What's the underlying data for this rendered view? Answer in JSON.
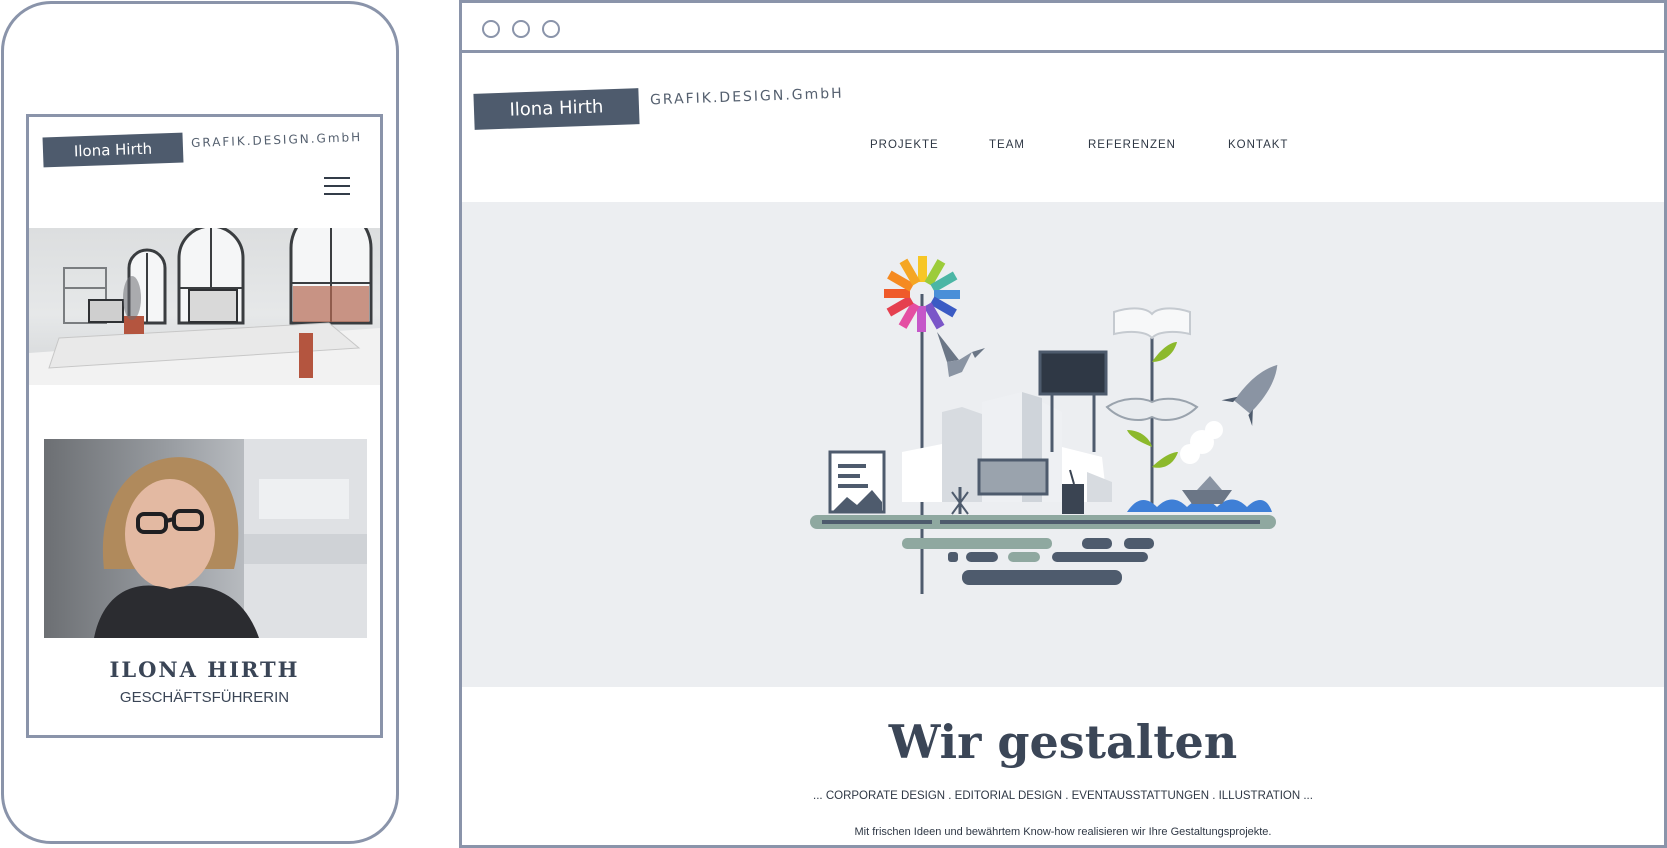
{
  "brand": {
    "name": "Ilona Hirth",
    "subtitle": "GRAFIK.DESIGN.GmbH"
  },
  "mobile": {
    "person_name": "ILONA HIRTH",
    "person_role": "GESCHÄFTSFÜHRERIN",
    "menu_icon": "hamburger-icon"
  },
  "browser": {
    "nav": [
      "PROJEKTE",
      "TEAM",
      "REFERENZEN",
      "KONTAKT"
    ],
    "headline": "Wir gestalten",
    "tagline": "... CORPORATE DESIGN . EDITORIAL DESIGN . EVENTAUSSTATTUNGEN . ILLUSTRATION ...",
    "intro": "Mit frischen Ideen und bewährtem Know-how realisieren wir Ihre Gestaltungsprojekte."
  },
  "colors": {
    "frame": "#8a94aa",
    "logo_bg": "#4e5b6d",
    "hero_bg": "#eceef1",
    "text_dark": "#3b4657",
    "water": "#3f7fd6",
    "leaf": "#8cb92c"
  }
}
